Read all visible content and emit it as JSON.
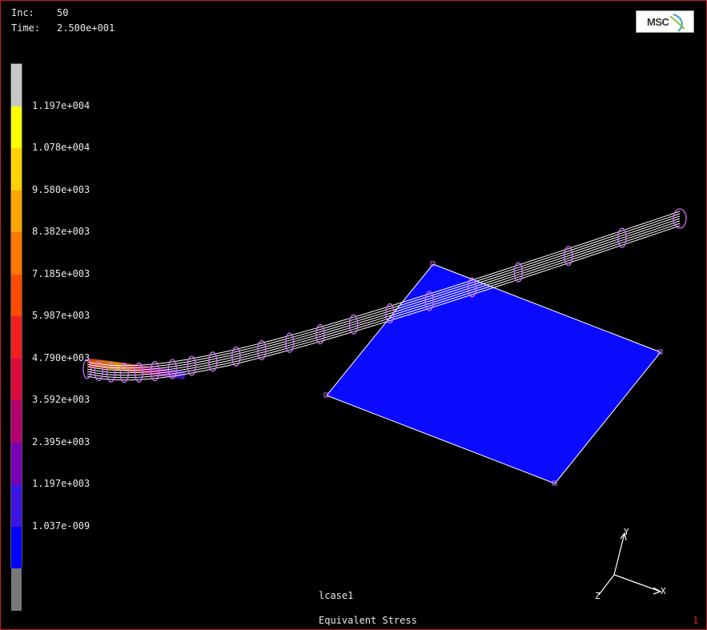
{
  "header": {
    "inc_label": "Inc:",
    "inc_value": "50",
    "time_label": "Time:",
    "time_value": "2.500e+001"
  },
  "logo": {
    "text": "MSC"
  },
  "legend": {
    "levels": [
      {
        "label": "1.197e+004",
        "color": "#ffff00"
      },
      {
        "label": "1.078e+004",
        "color": "#ffd200"
      },
      {
        "label": "9.580e+003",
        "color": "#ffa500"
      },
      {
        "label": "8.382e+003",
        "color": "#ff7800"
      },
      {
        "label": "7.185e+003",
        "color": "#ff4b00"
      },
      {
        "label": "5.987e+003",
        "color": "#f01e1e"
      },
      {
        "label": "4.790e+003",
        "color": "#dc0a3c"
      },
      {
        "label": "3.592e+003",
        "color": "#b4006e"
      },
      {
        "label": "2.395e+003",
        "color": "#7800b4"
      },
      {
        "label": "1.197e+003",
        "color": "#3c14e6"
      },
      {
        "label": "1.037e-009",
        "color": "#0000ff"
      }
    ],
    "top_color": "#c8c8c8",
    "bottom_color": "#787878"
  },
  "plate": {
    "color": "#0a0aff"
  },
  "pipe": {
    "color": "#ffffff",
    "ring_color": "#d070ff"
  },
  "axes": {
    "x": "X",
    "y": "Y",
    "z": "Z"
  },
  "footer": {
    "loadcase": "lcase1",
    "result_name": "Equivalent Stress",
    "corner_number": "1"
  }
}
